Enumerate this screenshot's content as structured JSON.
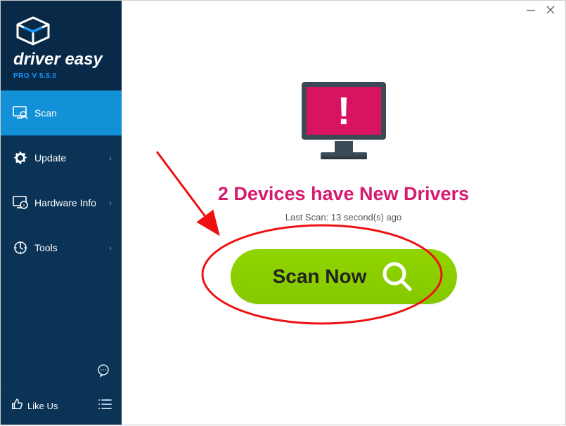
{
  "brand": {
    "name": "driver easy",
    "version_label": "PRO V 5.5.0"
  },
  "sidebar": {
    "items": [
      {
        "label": "Scan"
      },
      {
        "label": "Update"
      },
      {
        "label": "Hardware Info"
      },
      {
        "label": "Tools"
      }
    ],
    "like_label": "Like Us"
  },
  "main": {
    "headline": "2 Devices have New Drivers",
    "last_scan": "Last Scan: 13 second(s) ago",
    "scan_button": "Scan Now"
  },
  "colors": {
    "accent_pink": "#d61a6f",
    "accent_green": "#8cd100",
    "sidebar_bg": "#0a3356",
    "sidebar_active": "#1290d8"
  }
}
